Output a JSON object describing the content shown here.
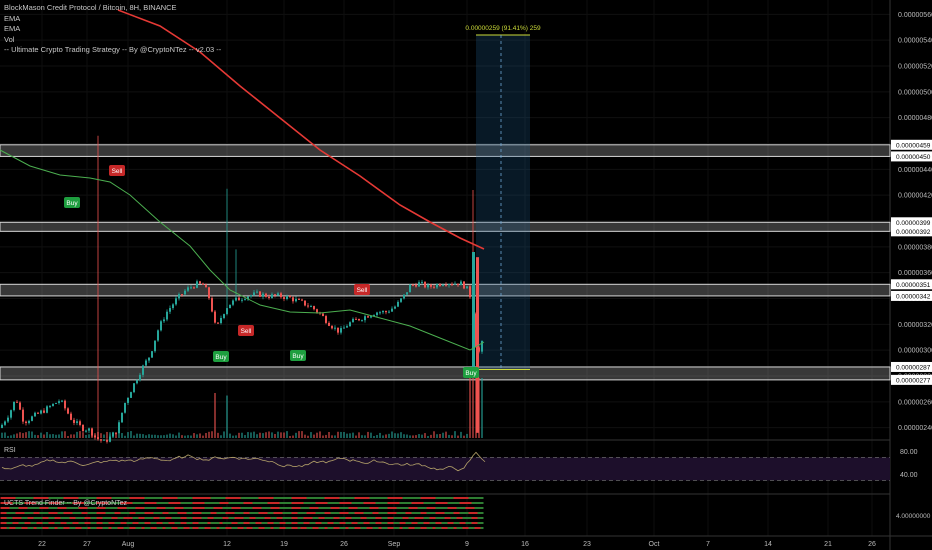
{
  "legend": {
    "title": "BlockMason Credit Protocol / Bitcoin, 8H, BINANCE",
    "ema1": "EMA",
    "ema2": "EMA",
    "vol": "Vol",
    "strategy": "-- Ultimate Crypto Trading Strategy -- By @CryptoNTez -- v2.03 --"
  },
  "colors": {
    "background": "#000000",
    "up": "#26a69a",
    "down": "#ef5350",
    "ema_fast": "#4caf50",
    "ema_slow": "#e53935",
    "zone": "#ffffff",
    "measure": "#cddc39",
    "rsi_line": "#b5a36a",
    "rsi_fill": "#1d0f2b",
    "buy": "#1e9e3f",
    "sell": "#c62828"
  },
  "price_axis": {
    "ticks": [
      "0.00000560",
      "0.00000540",
      "0.00000520",
      "0.00000500",
      "0.00000480",
      "0.00000460",
      "0.00000440",
      "0.00000420",
      "0.00000400",
      "0.00000380",
      "0.00000360",
      "0.00000340",
      "0.00000320",
      "0.00000300",
      "0.00000280",
      "0.00000260",
      "0.00000240"
    ],
    "zone_labels": [
      "0.00000459",
      "0.00000450",
      "0.00000399",
      "0.00000392",
      "0.00000351",
      "0.00000342",
      "0.00000287",
      "0.00000277"
    ]
  },
  "x_axis": {
    "ticks": [
      "22",
      "27",
      "Aug",
      "12",
      "19",
      "26",
      "Sep",
      "9",
      "16",
      "23",
      "Oct",
      "7",
      "14",
      "21",
      "26"
    ]
  },
  "measure": {
    "label": "0.00000259 (91.41%) 259"
  },
  "rsi": {
    "label": "RSI",
    "ticks": [
      "80.00",
      "40.00"
    ]
  },
  "trend": {
    "label": "UCTS Trend Finder -- By @CryptoNTez",
    "tick": "4.00000000"
  },
  "signals": [
    {
      "text": "Buy"
    },
    {
      "text": "Sell"
    },
    {
      "text": "Buy"
    },
    {
      "text": "Sell"
    },
    {
      "text": "Buy"
    },
    {
      "text": "Sell"
    },
    {
      "text": "Buy"
    }
  ],
  "chart_data": {
    "type": "candlestick",
    "title": "BlockMason Credit Protocol / Bitcoin, 8H, BINANCE",
    "ylim": [
      2.32e-06,
      5.68e-06
    ],
    "zones": [
      [
        4.5e-06,
        4.59e-06
      ],
      [
        3.92e-06,
        3.99e-06
      ],
      [
        3.42e-06,
        3.51e-06
      ],
      [
        2.77e-06,
        2.87e-06
      ]
    ],
    "measure": {
      "from": 2.85e-06,
      "to": 5.44e-06,
      "change": "0.00000259 (91.41%) 259"
    },
    "rsi_ylim": [
      10,
      95
    ],
    "rsi_band": [
      70,
      30
    ]
  }
}
